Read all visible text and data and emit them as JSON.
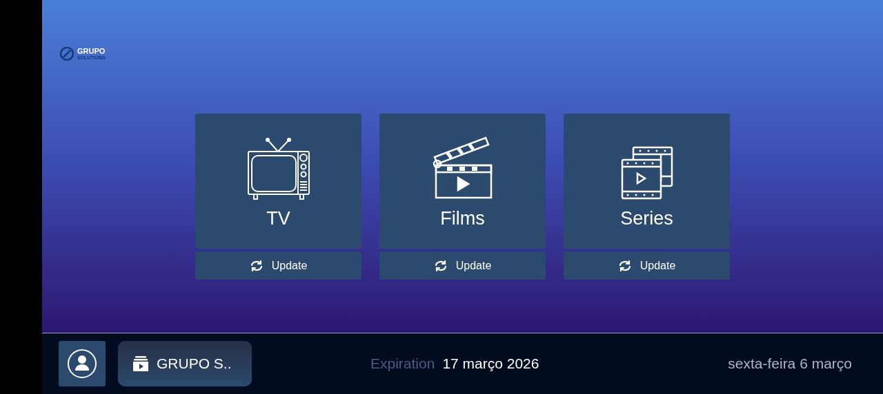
{
  "logo": {
    "line_1": "GRUPO",
    "line_2": "SOLUTIONS"
  },
  "sections": [
    {
      "kind": "tv",
      "label": "TV",
      "update": "Update"
    },
    {
      "kind": "films",
      "label": "Films",
      "update": "Update"
    },
    {
      "kind": "series",
      "label": "Series",
      "update": "Update"
    }
  ],
  "bottom_bar": {
    "playlist": "GRUPO S..",
    "expiration_label": "Expiration",
    "expiration_date": "17 março 2026",
    "date": "sexta-feira 6 março"
  }
}
